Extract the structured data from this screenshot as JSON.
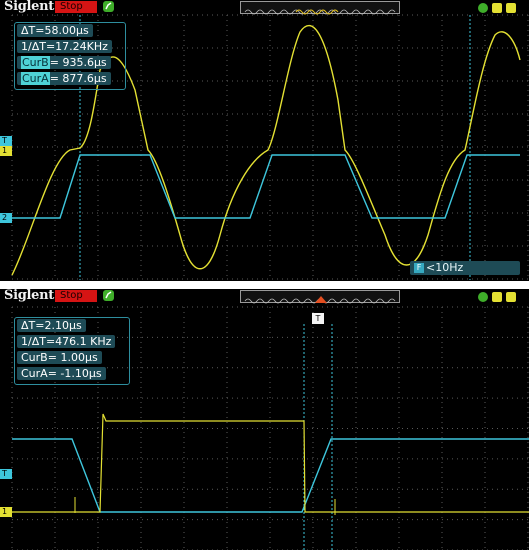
{
  "top_panel": {
    "brand": "Siglent",
    "run_state": "Stop",
    "readouts": [
      {
        "label": "ΔT=",
        "value": "58.00μs"
      },
      {
        "label": "1/ΔT=",
        "value": "17.24KHz"
      },
      {
        "label": "CurB",
        "value": "= 935.6μs"
      },
      {
        "label": "CurA",
        "value": "= 877.6μs"
      }
    ],
    "trigger_frequency": "<10Hz",
    "markers": {
      "trigger": "T",
      "channel1": "1",
      "channel2": "2"
    }
  },
  "bottom_panel": {
    "brand": "Siglent",
    "run_state": "Stop",
    "readouts": [
      {
        "label": "ΔT=",
        "value": "2.10μs"
      },
      {
        "label": "1/ΔT=",
        "value": "476.1 KHz"
      },
      {
        "label": "CurB",
        "value": "= 1.00μs"
      },
      {
        "label": "CurA",
        "value": "= -1.10μs"
      }
    ],
    "trigger_position_label": "T",
    "markers": {
      "trigger": "T",
      "channel1": "1"
    }
  },
  "colors": {
    "channel1": "#e3e033",
    "channel2": "#3ec6dc",
    "grid": "#5a5a5a",
    "stop_badge": "#d61414",
    "readout_bg": "#1e4b56"
  }
}
